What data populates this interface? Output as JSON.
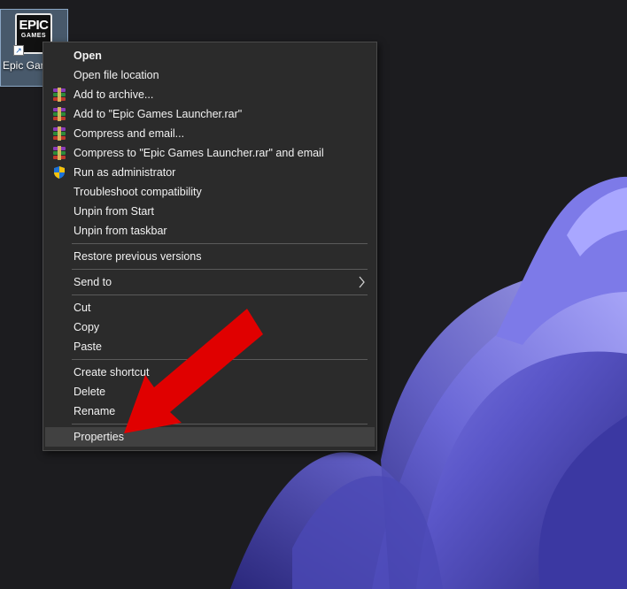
{
  "desktop": {
    "icon_logo_line1": "EPIC",
    "icon_logo_line2": "GAMES",
    "icon_label": "Epic Games Launcher"
  },
  "context_menu": {
    "items": [
      {
        "label": "Open",
        "icon": "none",
        "bold": true
      },
      {
        "label": "Open file location",
        "icon": "none"
      },
      {
        "label": "Add to archive...",
        "icon": "winrar-icon"
      },
      {
        "label": "Add to \"Epic Games Launcher.rar\"",
        "icon": "winrar-icon"
      },
      {
        "label": "Compress and email...",
        "icon": "winrar-icon"
      },
      {
        "label": "Compress to \"Epic Games Launcher.rar\" and email",
        "icon": "winrar-icon"
      },
      {
        "label": "Run as administrator",
        "icon": "uac-shield-icon"
      },
      {
        "label": "Troubleshoot compatibility",
        "icon": "none"
      },
      {
        "label": "Unpin from Start",
        "icon": "none"
      },
      {
        "label": "Unpin from taskbar",
        "icon": "none"
      },
      {
        "label": "Restore previous versions",
        "icon": "none"
      },
      {
        "label": "Send to",
        "icon": "chevron-right-icon",
        "submenu": true
      },
      {
        "label": "Cut",
        "icon": "none"
      },
      {
        "label": "Copy",
        "icon": "none"
      },
      {
        "label": "Paste",
        "icon": "none"
      },
      {
        "label": "Create shortcut",
        "icon": "none"
      },
      {
        "label": "Delete",
        "icon": "none"
      },
      {
        "label": "Rename",
        "icon": "none"
      },
      {
        "label": "Properties",
        "icon": "none",
        "highlighted": true
      }
    ]
  },
  "colors": {
    "desktop_background": "#1c1c1f",
    "menu_background": "#2b2b2b",
    "menu_hover": "#414141",
    "annotation_arrow": "#e00000",
    "wallpaper_bloom": "#5a58c8"
  }
}
